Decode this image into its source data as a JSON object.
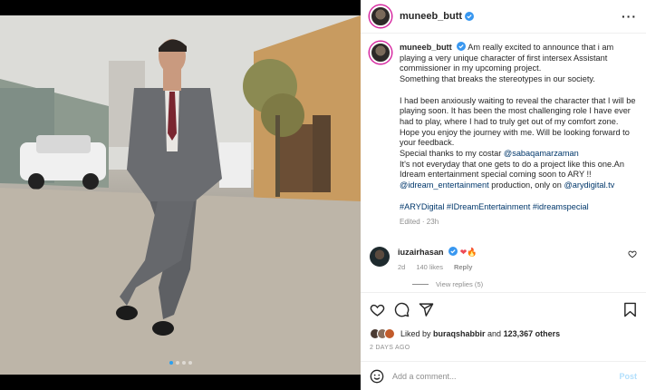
{
  "post": {
    "username": "muneeb_butt",
    "more_icon": "ellipsis-icon",
    "caption": [
      "Am really excited to announce that i am playing a very unique character of first intersex Assistant commissioner in my upcoming project.",
      "Something that breaks the stereotypes in our society.",
      "",
      "I had been anxiously waiting to reveal the character that I will be playing soon. It has been the most challenging role I have ever had to play, where I had to truly get out of my comfort zone. Hope you enjoy the journey with me. Will be looking forward to your feedback."
    ],
    "costar_prefix": "Special thanks to my costar ",
    "costar_handle": "@sabaqamarzaman",
    "line_project": "It's not everyday that one gets to do a project like this one.An Idream entertainment special coming soon to ARY !!",
    "production_handle": "@idream_entertainment",
    "production_mid": " production, only on ",
    "channel_handle": "@arydigital.tv",
    "hashtags": "#ARYDigital #IDreamEntertainment #idreamspecial",
    "edited": "Edited · 23h"
  },
  "comment": {
    "username": "iuzairhasan",
    "emojis": "❤🔥",
    "time": "2d",
    "likes": "140 likes",
    "reply": "Reply",
    "view_replies": "View replies (5)"
  },
  "actions": {
    "liked_by_prefix": "Liked by ",
    "liked_by_user": "buraqshabbir",
    "liked_by_and": " and ",
    "liked_by_others": "123,367 others",
    "date": "2 DAYS AGO"
  },
  "add_comment": {
    "placeholder": "Add a comment...",
    "post_label": "Post"
  },
  "colors": {
    "link": "#00376b",
    "verified": "#3897f0",
    "heart": "#ed4956"
  }
}
